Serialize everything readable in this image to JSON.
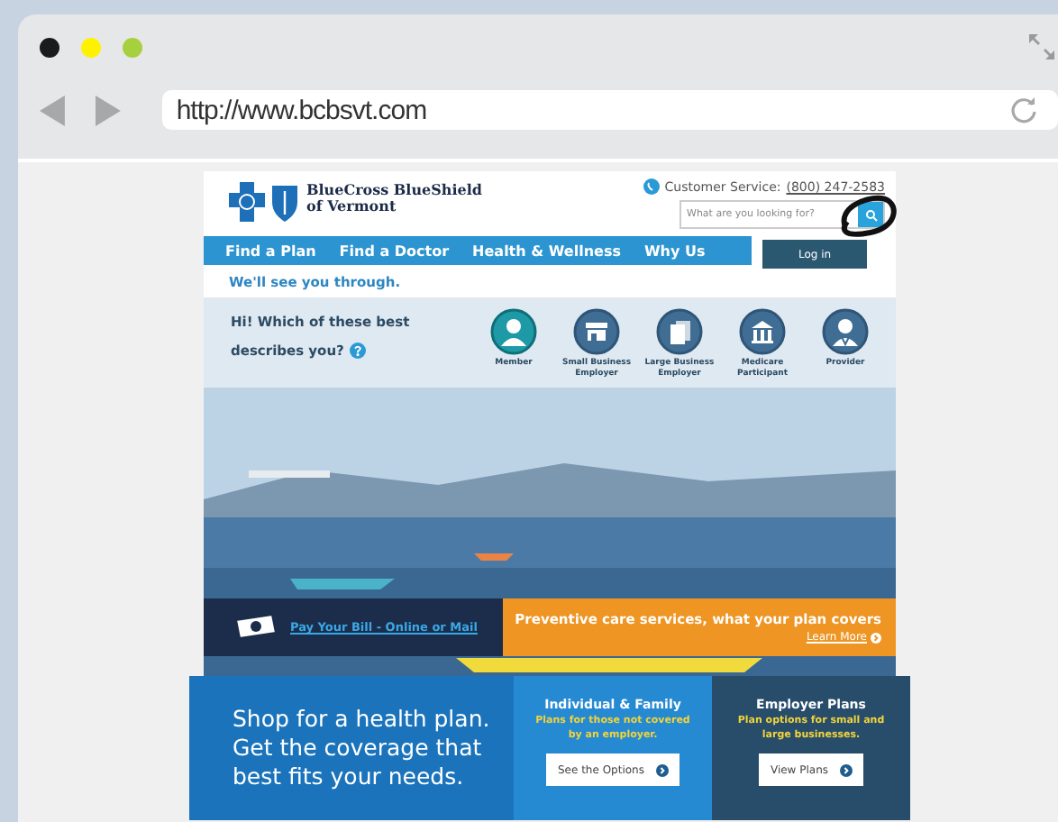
{
  "browser": {
    "url": "http://www.bcbsvt.com"
  },
  "header": {
    "logo_line1": "BlueCross BlueShield",
    "logo_line2": "of Vermont",
    "service_label": "Customer Service:",
    "service_phone": "(800) 247-2583",
    "search_placeholder": "What are you looking for?",
    "login": "Log in"
  },
  "nav": [
    {
      "label": "Find a Plan"
    },
    {
      "label": "Find a Doctor"
    },
    {
      "label": "Health & Wellness"
    },
    {
      "label": "Why Us"
    }
  ],
  "tagline": "We'll see you through.",
  "chooser": {
    "question": "Hi! Which of these best describes you?",
    "options": [
      {
        "label": "Member",
        "kind": "person",
        "selected": true
      },
      {
        "label": "Small Business Employer",
        "kind": "store",
        "selected": false
      },
      {
        "label": "Large Business Employer",
        "kind": "documents",
        "selected": false
      },
      {
        "label": "Medicare Participant",
        "kind": "columns",
        "selected": false
      },
      {
        "label": "Provider",
        "kind": "provider",
        "selected": false
      }
    ]
  },
  "notice": {
    "bill_link": "Pay Your Bill - Online or Mail",
    "promo": "Preventive care services, what your plan covers",
    "learn_more": "Learn More"
  },
  "shop": {
    "headline": "Shop for a health plan. Get the coverage that best fits your needs.",
    "plans": [
      {
        "title": "Individual & Family",
        "subtitle": "Plans for those not covered by an employer.",
        "button": "See the Options"
      },
      {
        "title": "Employer Plans",
        "subtitle": "Plan options for small and large businesses.",
        "button": "View Plans"
      }
    ]
  }
}
